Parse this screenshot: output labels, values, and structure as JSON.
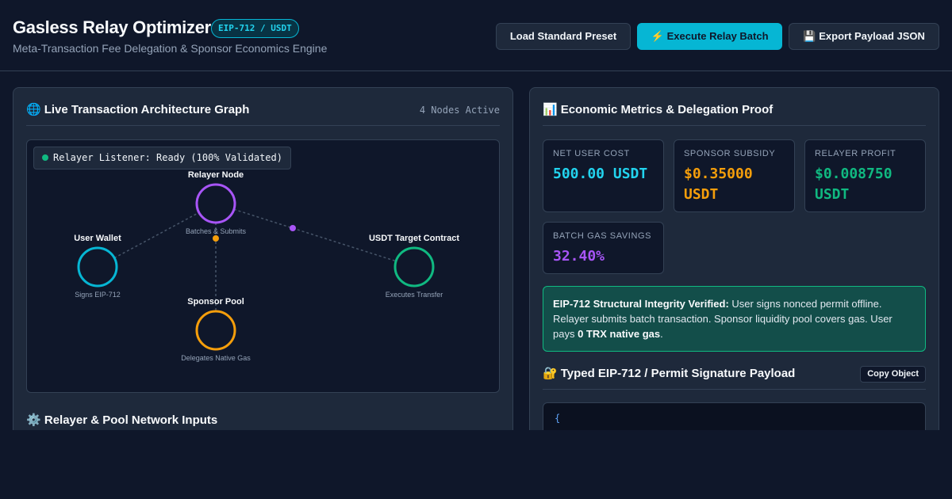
{
  "header": {
    "title": "Gasless Relay Optimizer",
    "badge": "EIP-712 / USDT",
    "subtitle": "Meta-Transaction Fee Delegation & Sponsor Economics Engine",
    "buttons": {
      "preset": "Load Standard Preset",
      "execute_icon": "⚡",
      "execute": "Execute Relay Batch",
      "export_icon": "💾",
      "export": "Export Payload JSON"
    }
  },
  "graph_panel": {
    "icon": "🌐",
    "title": "Live Transaction Architecture Graph",
    "nodes_active": "4 Nodes Active",
    "listener": "Relayer Listener: Ready (100% Validated)",
    "nodes": {
      "relayer": {
        "label": "Relayer Node",
        "sub": "Batches & Submits",
        "color": "#a855f7"
      },
      "wallet": {
        "label": "User Wallet",
        "sub": "Signs EIP-712",
        "color": "#06b6d4"
      },
      "target": {
        "label": "USDT Target Contract",
        "sub": "Executes Transfer",
        "color": "#10b981"
      },
      "sponsor": {
        "label": "Sponsor Pool",
        "sub": "Delegates Native Gas",
        "color": "#f59e0b"
      }
    },
    "inputs_icon": "⚙️",
    "inputs_title": "Relayer & Pool Network Inputs"
  },
  "metrics_panel": {
    "icon": "📊",
    "title": "Economic Metrics & Delegation Proof",
    "metrics": [
      {
        "label": "Net User Cost",
        "value": "500.00 USDT",
        "color": "#22d3ee"
      },
      {
        "label": "Sponsor Subsidy",
        "value": "$0.35000 USDT",
        "color": "#f59e0b"
      },
      {
        "label": "Relayer Profit",
        "value": "$0.008750 USDT",
        "color": "#10b981"
      },
      {
        "label": "Batch Gas Savings",
        "value": "32.40%",
        "color": "#a855f7"
      }
    ],
    "verify": {
      "heading": "EIP-712 Structural Integrity Verified:",
      "text": " User signs nonced permit offline. Relayer submits batch transaction. Sponsor liquidity pool covers gas. User pays ",
      "emphasis": "0 TRX native gas",
      "end": "."
    },
    "payload_icon": "🔐",
    "payload_title": "Typed EIP-712 / Permit Signature Payload",
    "copy_button": "Copy Object",
    "code_first_line": "{"
  }
}
